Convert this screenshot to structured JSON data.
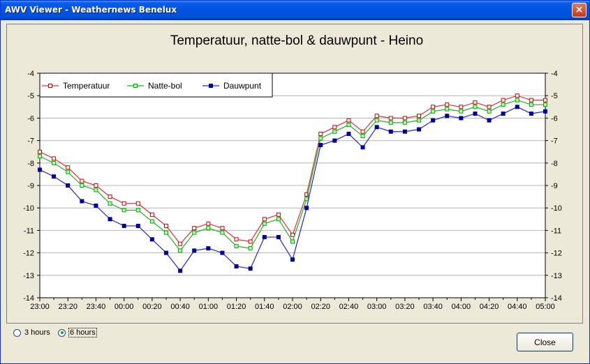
{
  "window": {
    "title": "AWV Viewer - Weathernews Benelux",
    "close_glyph": "×"
  },
  "chart_data": {
    "type": "line",
    "title": "Temperatuur, natte-bol & dauwpunt - Heino",
    "xlabel": "",
    "ylabel": "",
    "ylim": [
      -14,
      -4
    ],
    "yticks": [
      -4,
      -5,
      -6,
      -7,
      -8,
      -9,
      -10,
      -11,
      -12,
      -13,
      -14
    ],
    "grid": true,
    "legend_position": "top-left",
    "x": [
      "23:00",
      "23:10",
      "23:20",
      "23:30",
      "23:40",
      "23:50",
      "00:00",
      "00:10",
      "00:20",
      "00:30",
      "00:40",
      "00:50",
      "01:00",
      "01:10",
      "01:20",
      "01:30",
      "01:40",
      "01:50",
      "02:00",
      "02:10",
      "02:20",
      "02:30",
      "02:40",
      "02:50",
      "03:00",
      "03:10",
      "03:20",
      "03:30",
      "03:40",
      "03:50",
      "04:00",
      "04:10",
      "04:20",
      "04:30",
      "04:40",
      "04:50",
      "05:00"
    ],
    "x_tick_labels": [
      "23:00",
      "23:20",
      "23:40",
      "00:00",
      "00:20",
      "00:40",
      "01:00",
      "01:20",
      "01:40",
      "02:00",
      "02:20",
      "02:40",
      "03:00",
      "03:20",
      "03:40",
      "04:00",
      "04:20",
      "04:40",
      "05:00"
    ],
    "series": [
      {
        "name": "Temperatuur",
        "color": "#e03030",
        "marker": "#cc0000",
        "values": [
          -7.5,
          -7.8,
          -8.2,
          -8.8,
          -9.0,
          -9.5,
          -9.8,
          -9.8,
          -10.3,
          -10.8,
          -11.6,
          -10.9,
          -10.7,
          -10.9,
          -11.4,
          -11.5,
          -10.5,
          -10.3,
          -11.2,
          -9.4,
          -6.7,
          -6.4,
          -6.1,
          -6.6,
          -5.9,
          -6.0,
          -6.0,
          -5.9,
          -5.5,
          -5.4,
          -5.5,
          -5.3,
          -5.5,
          -5.2,
          -5.0,
          -5.2,
          -5.2
        ]
      },
      {
        "name": "Natte-bol",
        "color": "#20b020",
        "marker": "#00aa00",
        "values": [
          -7.7,
          -8.0,
          -8.4,
          -9.0,
          -9.2,
          -9.8,
          -10.1,
          -10.1,
          -10.6,
          -11.1,
          -11.9,
          -11.1,
          -10.9,
          -11.1,
          -11.7,
          -11.8,
          -10.7,
          -10.5,
          -11.5,
          -9.6,
          -6.9,
          -6.6,
          -6.3,
          -6.8,
          -6.1,
          -6.2,
          -6.2,
          -6.1,
          -5.7,
          -5.6,
          -5.7,
          -5.5,
          -5.7,
          -5.4,
          -5.2,
          -5.4,
          -5.4
        ]
      },
      {
        "name": "Dauwpunt",
        "color": "#2020e0",
        "marker": "#000099",
        "values": [
          -8.3,
          -8.6,
          -9.0,
          -9.7,
          -9.9,
          -10.5,
          -10.8,
          -10.8,
          -11.4,
          -12.0,
          -12.8,
          -11.9,
          -11.8,
          -12.0,
          -12.6,
          -12.7,
          -11.3,
          -11.3,
          -12.3,
          -10.0,
          -7.2,
          -7.0,
          -6.7,
          -7.3,
          -6.4,
          -6.6,
          -6.6,
          -6.5,
          -6.1,
          -5.9,
          -6.0,
          -5.8,
          -6.1,
          -5.8,
          -5.5,
          -5.8,
          -5.7
        ]
      }
    ]
  },
  "controls": {
    "options": [
      {
        "label": "3 hours",
        "checked": false
      },
      {
        "label": "6 hours",
        "checked": true
      }
    ],
    "close_label": "Close"
  }
}
